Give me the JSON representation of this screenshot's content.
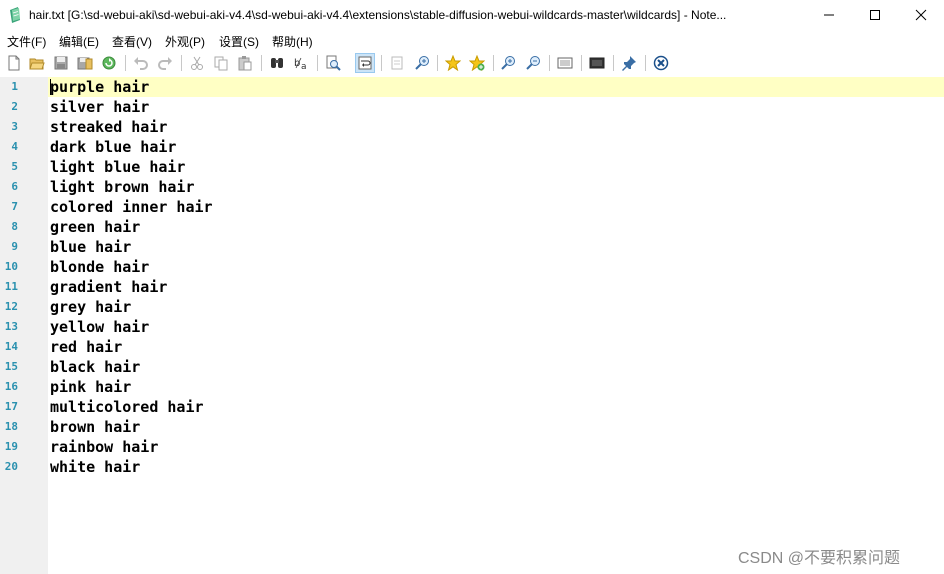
{
  "window": {
    "title": "hair.txt [G:\\sd-webui-aki\\sd-webui-aki-v4.4\\sd-webui-aki-v4.4\\extensions\\stable-diffusion-webui-wildcards-master\\wildcards] - Note..."
  },
  "menu": [
    "文件(F)",
    "编辑(E)",
    "查看(V)",
    "外观(P)",
    "设置(S)",
    "帮助(H)"
  ],
  "toolbar": {
    "icons": [
      "new-file-icon",
      "open-folder-icon",
      "save-icon",
      "save-as-icon",
      "reload-icon",
      "undo-icon",
      "redo-icon",
      "cut-icon",
      "copy-icon",
      "paste-icon",
      "find-binoculars-icon",
      "replace-icon",
      "find-next-icon",
      "word-wrap-icon",
      "show-whitespace-icon",
      "zoom-find-icon",
      "favorite-star-icon",
      "add-favorite-icon",
      "zoom-in-icon",
      "zoom-out-icon",
      "view-scheme-icon",
      "window-icon",
      "pin-icon",
      "exit-icon"
    ]
  },
  "editor": {
    "lines": [
      {
        "n": "1",
        "text": "purple hair"
      },
      {
        "n": "2",
        "text": "silver hair"
      },
      {
        "n": "3",
        "text": "streaked hair"
      },
      {
        "n": "4",
        "text": "dark blue hair"
      },
      {
        "n": "5",
        "text": "light blue hair"
      },
      {
        "n": "6",
        "text": "light brown hair"
      },
      {
        "n": "7",
        "text": "colored inner hair"
      },
      {
        "n": "8",
        "text": "green hair"
      },
      {
        "n": "9",
        "text": "blue hair"
      },
      {
        "n": "10",
        "text": "blonde hair"
      },
      {
        "n": "11",
        "text": "gradient hair"
      },
      {
        "n": "12",
        "text": "grey hair"
      },
      {
        "n": "13",
        "text": "yellow hair"
      },
      {
        "n": "14",
        "text": "red hair"
      },
      {
        "n": "15",
        "text": "black hair"
      },
      {
        "n": "16",
        "text": "pink hair"
      },
      {
        "n": "17",
        "text": "multicolored hair"
      },
      {
        "n": "18",
        "text": "brown hair"
      },
      {
        "n": "19",
        "text": "rainbow hair"
      },
      {
        "n": "20",
        "text": "white hair"
      }
    ]
  },
  "watermark": "CSDN @不要积累问题",
  "colors": {
    "current_line": "#ffffc4",
    "gutter": "#f0f0f0",
    "line_number": "#2b91af"
  }
}
